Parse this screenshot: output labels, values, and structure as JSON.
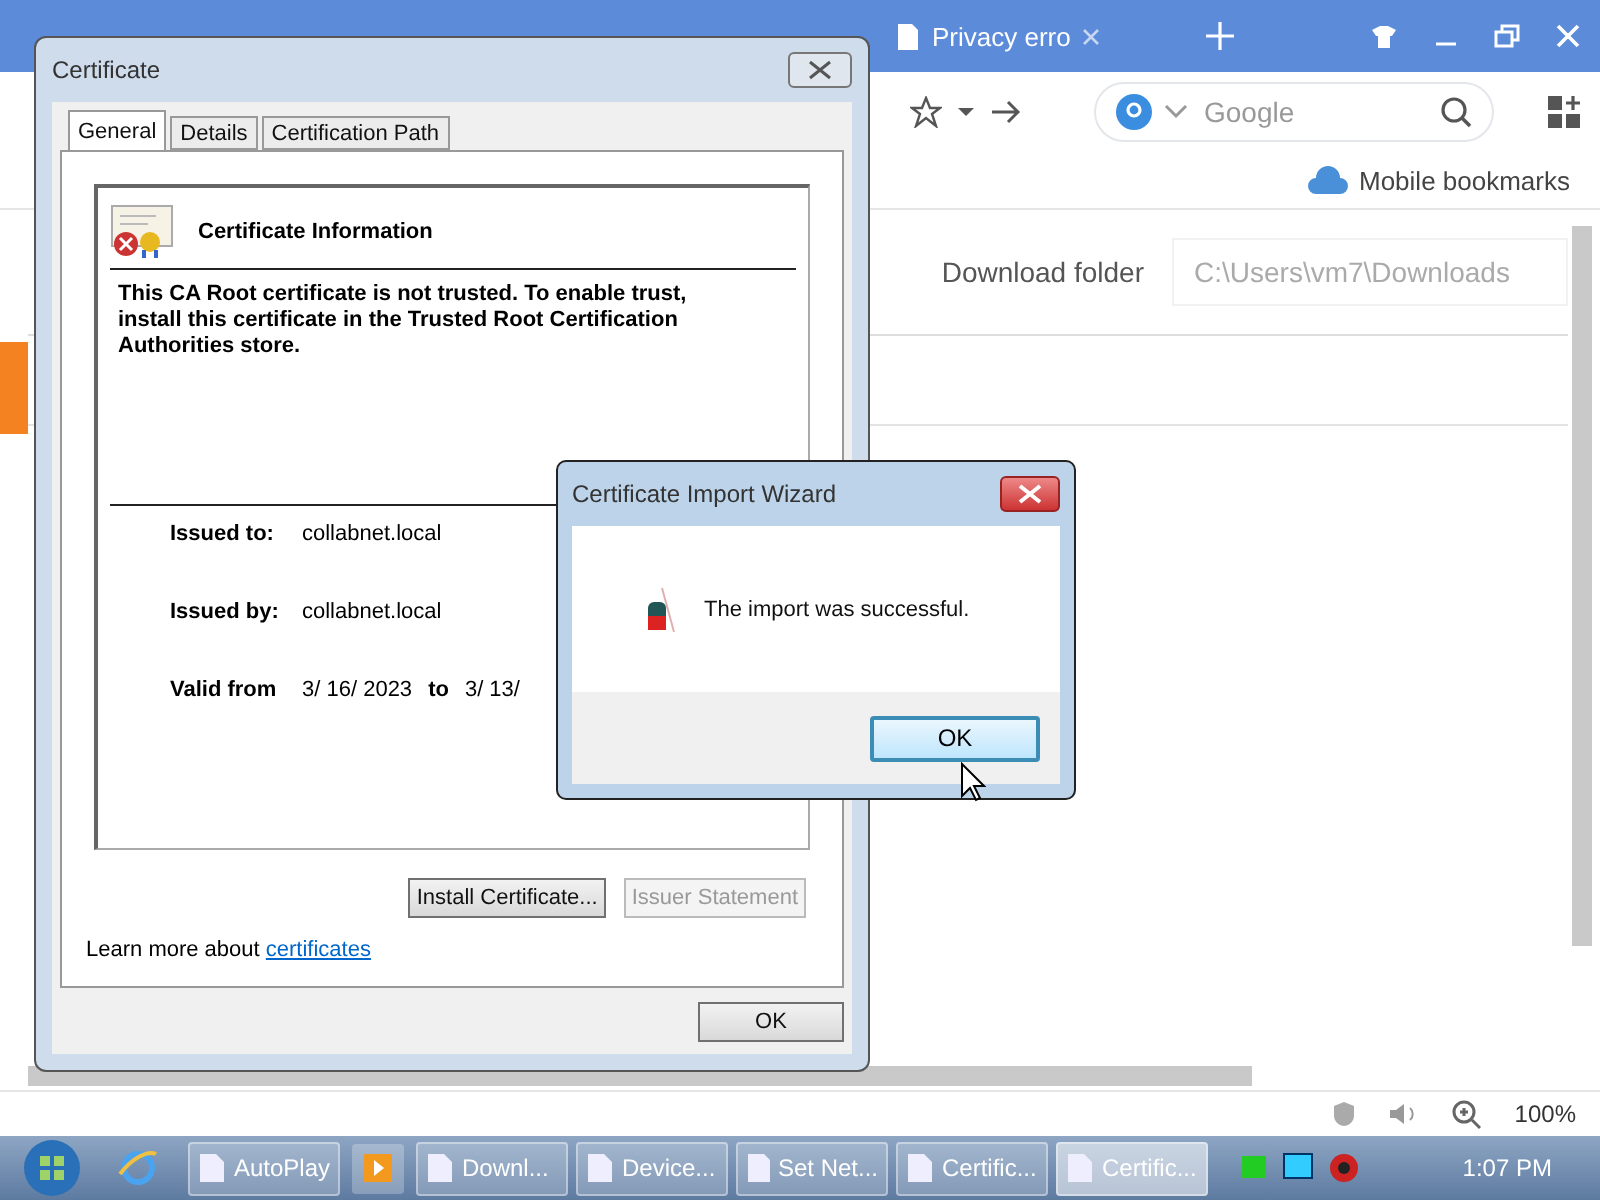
{
  "browser": {
    "tabs": [
      {
        "title": "Privacy erro",
        "selected": false
      }
    ],
    "search": {
      "placeholder": "Google"
    },
    "bookmarks": [
      "Mobile bookmarks"
    ],
    "download": {
      "label": "Download folder",
      "placeholder": "C:\\Users\\vm7\\Downloads"
    },
    "zoom": "100%"
  },
  "certificate_dialog": {
    "title": "Certificate",
    "tabs": [
      {
        "label": "General",
        "selected": true
      },
      {
        "label": "Details",
        "selected": false
      },
      {
        "label": "Certification Path",
        "selected": false
      }
    ],
    "heading": "Certificate Information",
    "message": "This CA Root certificate is not trusted. To enable trust, install this certificate in the Trusted Root Certification Authorities store.",
    "fields": [
      {
        "label": "Issued to:",
        "value": "collabnet.local"
      },
      {
        "label": "Issued by:",
        "value": "collabnet.local"
      }
    ],
    "validity": {
      "label": "Valid from",
      "from": "3/ 16/ 2023",
      "to_label": "to",
      "to": "3/ 13/"
    },
    "buttons": [
      {
        "label": "Install Certificate...",
        "disabled": false
      },
      {
        "label": "Issuer Statement",
        "disabled": true
      }
    ],
    "learn_more": {
      "text": "Learn more about",
      "link": "certificates"
    },
    "ok": "OK"
  },
  "wizard": {
    "title": "Certificate Import Wizard",
    "message": "The import was successful.",
    "ok": "OK"
  },
  "taskbar": {
    "items": [
      {
        "label": "AutoPlay",
        "selected": false
      },
      {
        "label": "Downl...",
        "selected": false
      },
      {
        "label": "Device...",
        "selected": false
      },
      {
        "label": "Set Net...",
        "selected": false
      },
      {
        "label": "Certific...",
        "selected": false
      },
      {
        "label": "Certific...",
        "selected": true
      }
    ],
    "clock": "1:07 PM"
  }
}
